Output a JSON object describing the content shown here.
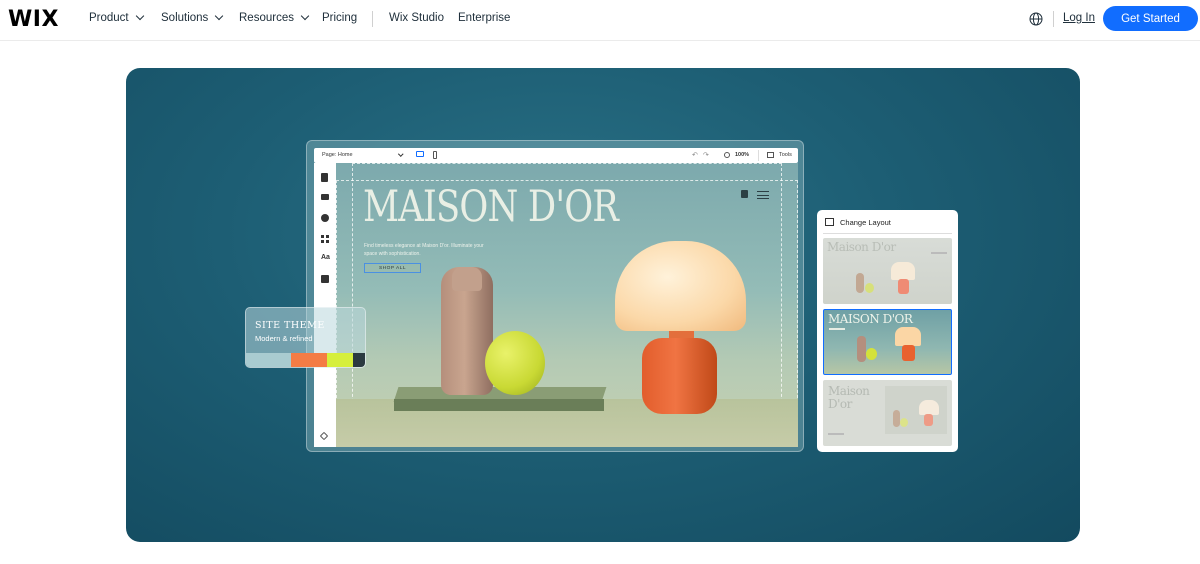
{
  "nav": {
    "logo": "WIX",
    "items": [
      {
        "label": "Product",
        "dropdown": true
      },
      {
        "label": "Solutions",
        "dropdown": true
      },
      {
        "label": "Resources",
        "dropdown": true
      },
      {
        "label": "Pricing",
        "dropdown": false
      },
      {
        "label": "Wix Studio",
        "dropdown": false
      },
      {
        "label": "Enterprise",
        "dropdown": false
      }
    ],
    "language_icon": "globe-icon",
    "login_label": "Log In",
    "cta_label": "Get Started",
    "cta_color": "#116dff"
  },
  "editor": {
    "toolbar": {
      "page_label": "Page: Home",
      "zoom": "100%",
      "tools_label": "Tools"
    },
    "sidebar_icons": [
      "pages-icon",
      "sections-icon",
      "add-icon",
      "apps-icon",
      "design-icon",
      "business-icon",
      "layers-icon"
    ],
    "site": {
      "title": "MAISON D'OR",
      "description": "Find timeless elegance at Maison D'or. Illuminate your space with sophistication.",
      "button": "SHOP ALL"
    }
  },
  "theme_card": {
    "title": "SITE THEME",
    "subtitle": "Modern & refined",
    "swatches": [
      "#a9cbd0",
      "#f47c45",
      "#d6ef3c",
      "#2b3a40"
    ]
  },
  "layout_panel": {
    "title": "Change Layout",
    "thumbnails": [
      {
        "title": "Maison D'or",
        "selected": false
      },
      {
        "title": "MAISON D'OR",
        "selected": true
      },
      {
        "title": "Maison D'or",
        "selected": false
      }
    ]
  },
  "colors": {
    "hero_bg": "#1d5e74",
    "accent": "#116dff"
  }
}
